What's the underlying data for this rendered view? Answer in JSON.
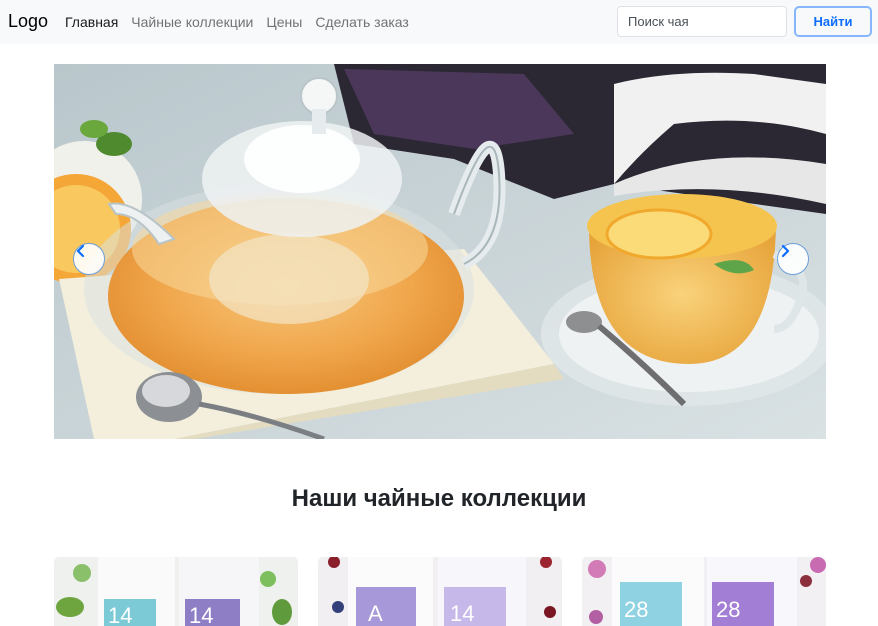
{
  "navbar": {
    "brand": "Logo",
    "links": [
      {
        "label": "Главная",
        "active": true
      },
      {
        "label": "Чайные коллекции",
        "active": false
      },
      {
        "label": "Цены",
        "active": false
      },
      {
        "label": "Сделать заказ",
        "active": false
      }
    ],
    "search_placeholder": "Поиск чая",
    "search_button": "Найти"
  },
  "carousel": {
    "prev_icon": "chevron-left-icon",
    "next_icon": "chevron-right-icon"
  },
  "collections": {
    "title": "Наши чайные коллекции",
    "cards": [
      {
        "pack_labels": [
          "14",
          "14"
        ]
      },
      {
        "pack_labels": [
          "A",
          "14"
        ]
      },
      {
        "pack_labels": [
          "28",
          "28"
        ]
      }
    ]
  },
  "colors": {
    "accent": "#0d6efd",
    "navbar_bg": "#f8f9fa"
  }
}
